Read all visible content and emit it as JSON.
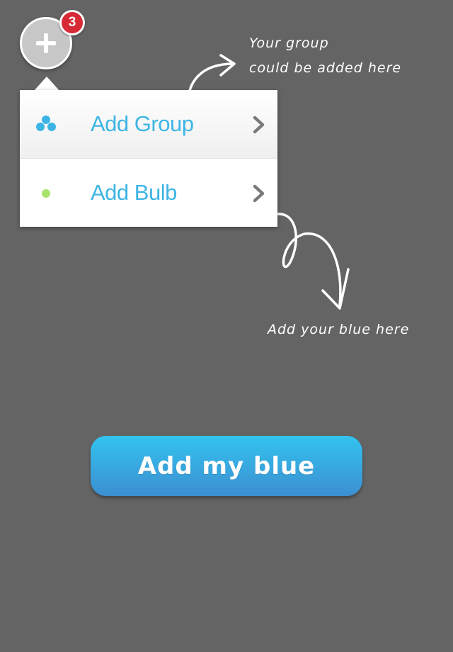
{
  "fab": {
    "icon": "plus-icon",
    "badge_count": "3",
    "badge_color": "#d62a35"
  },
  "menu": {
    "items": [
      {
        "label": "Add Group",
        "icon": "group-icon",
        "chevron": "chevron-right-icon"
      },
      {
        "label": "Add Bulb",
        "icon": "bulb-dot-icon",
        "chevron": "chevron-right-icon"
      }
    ],
    "label_color": "#3db5e4"
  },
  "notes": {
    "group_line1": "Your group",
    "group_line2": "could be added here",
    "bulb": "Add your blue here"
  },
  "cta": {
    "label": "Add my blue",
    "gradient": [
      "#33c3ef",
      "#3c8fd1"
    ]
  },
  "colors": {
    "background": "#646464"
  }
}
